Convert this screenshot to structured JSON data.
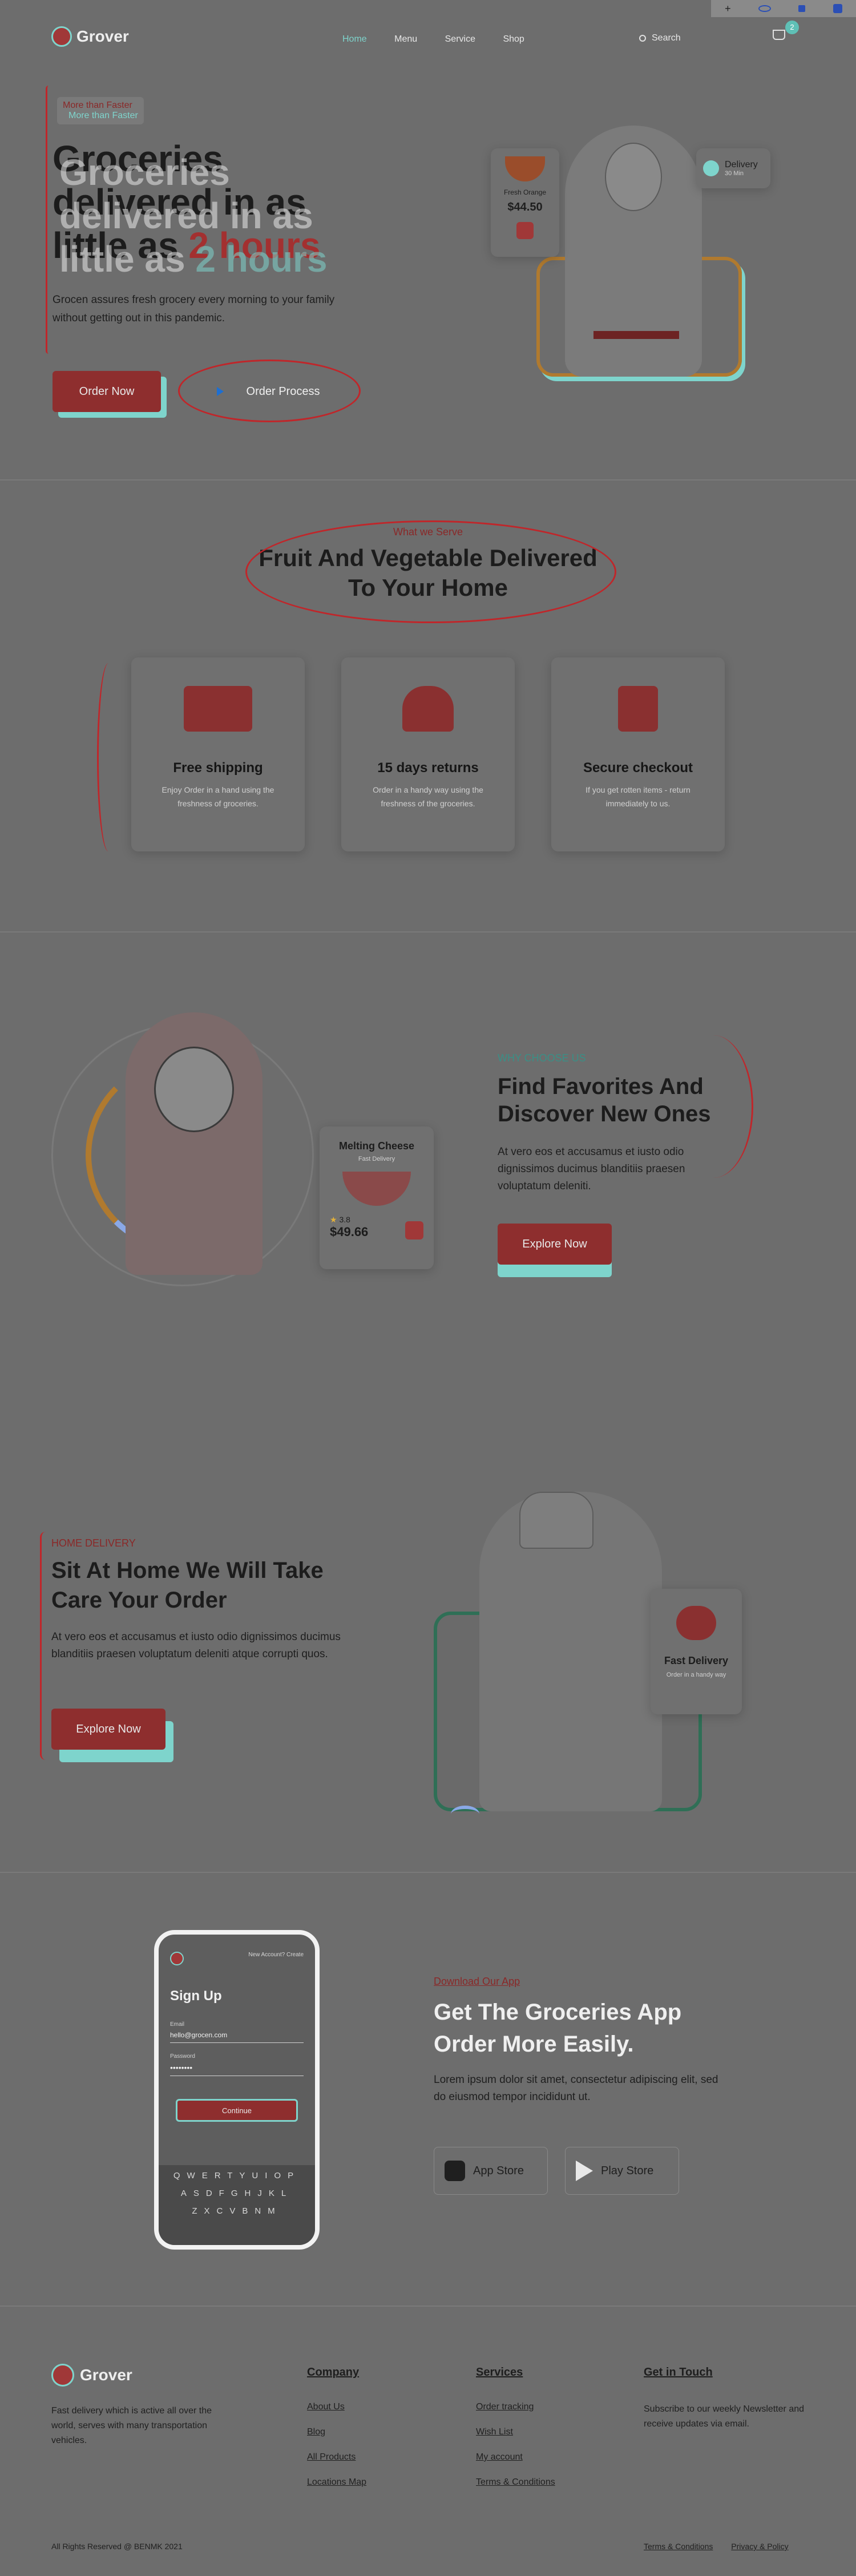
{
  "top_toolbar": {
    "icons": [
      "plus-icon",
      "eye-icon",
      "lock-icon",
      "extension-icon"
    ]
  },
  "brand": {
    "name": "Grover"
  },
  "nav": {
    "items": [
      "Home",
      "Menu",
      "Service",
      "Shop"
    ],
    "active": "Home",
    "search_placeholder": "Search",
    "cart_count": "2"
  },
  "hero": {
    "badge": "More than Faster",
    "title_line1": "Groceries",
    "title_line2": "delivered in as",
    "title_line3_prefix": "little as",
    "title_line3_accent": "2 hours",
    "description": "Grocen assures fresh grocery every morning to your family without getting out in this pandemic.",
    "primary_button": "Order Now",
    "secondary_button": "Order Process",
    "product_name": "Fresh Orange",
    "product_price": "$44.50",
    "delivery_label": "Delivery",
    "delivery_sub": "30 Min"
  },
  "features": {
    "eyebrow": "What we Serve",
    "title_line1": "Fruit And Vegetable Delivered",
    "title_line2": "To Your Home",
    "items": [
      {
        "title": "Free shipping",
        "text": "Enjoy Order in a hand using the freshness of groceries."
      },
      {
        "title": "15 days returns",
        "text": "Order in a handy way using the freshness of the groceries."
      },
      {
        "title": "Secure checkout",
        "text": "If you get rotten items - return immediately to us."
      }
    ]
  },
  "why": {
    "eyebrow": "WHY CHOOSE US",
    "title_line1": "Find Favorites And",
    "title_line2": "Discover New Ones",
    "text": "At vero eos et accusamus et iusto odio dignissimos ducimus blanditiis praesen voluptatum deleniti.",
    "button": "Explore Now",
    "product_name": "Melting Cheese",
    "product_sub": "Fast Delivery",
    "rating": "3.8",
    "price": "$49.66"
  },
  "home_delivery": {
    "eyebrow": "HOME DELIVERY",
    "title_line1": "Sit At Home We Will Take",
    "title_line2": "Care Your Order",
    "text": "At vero eos et accusamus et iusto odio dignissimos ducimus blanditiis praesen voluptatum deleniti atque corrupti quos.",
    "button": "Explore Now",
    "card_title": "Fast Delivery",
    "card_text": "Order in a handy way"
  },
  "app": {
    "eyebrow": "Download Our App",
    "title_line1": "Get The Groceries App",
    "title_line2": "Order More Easily.",
    "text": "Lorem ipsum dolor sit amet, consectetur adipiscing elit, sed do eiusmod tempor incididunt ut.",
    "apple": "App Store",
    "play": "Play Store",
    "phone": {
      "header_link": "New Account? Create",
      "title": "Sign Up",
      "email_label": "Email",
      "email_value": "hello@grocen.com",
      "password_label": "Password",
      "password_value": "••••••••",
      "button": "Continue",
      "keyboard_rows": [
        "QWERTYUIOP",
        "ASDFGHJKL",
        "ZXCVBNM"
      ]
    }
  },
  "footer": {
    "brand": "Grover",
    "about": "Fast delivery which is active all over the world, serves with many transportation vehicles.",
    "company": {
      "title": "Company",
      "links": [
        "About Us",
        "Blog",
        "All Products",
        "Locations Map"
      ]
    },
    "services": {
      "title": "Services",
      "links": [
        "Order tracking",
        "Wish List",
        "My account",
        "Terms & Conditions"
      ]
    },
    "contact": {
      "title": "Get in Touch",
      "text": "Subscribe to our weekly Newsletter and receive updates via email."
    },
    "copyright": "All Rights Reserved @ BENMK 2021",
    "bottom_links": [
      "Terms & Conditions",
      "Privacy & Policy"
    ]
  }
}
